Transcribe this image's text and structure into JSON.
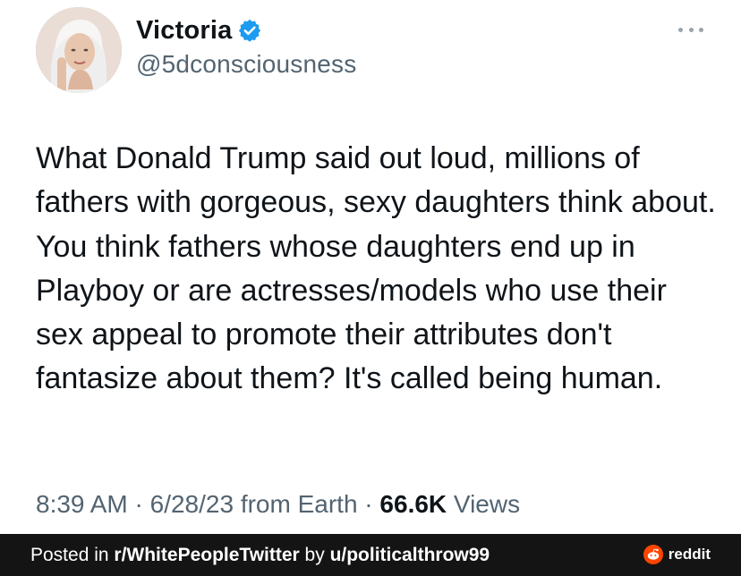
{
  "tweet": {
    "author": {
      "display_name": "Victoria",
      "handle": "@5dconsciousness",
      "verified": true
    },
    "text": "What Donald Trump said out loud, millions of fathers with gorgeous, sexy daughters think about. You think fathers whose daughters end up in Playboy or are actresses/models who use their sex appeal to promote their attributes don't fantasize about them? It's called being human.",
    "meta": {
      "time": "8:39 AM",
      "separator1": " · ",
      "date": "6/28/23",
      "source": " from Earth",
      "separator2": " · ",
      "views_count": "66.6K",
      "views_label": " Views"
    }
  },
  "footer": {
    "posted_in_prefix": "Posted in ",
    "subreddit": "r/WhitePeopleTwitter",
    "by_text": " by ",
    "user": "u/politicalthrow99",
    "brand": "reddit"
  },
  "colors": {
    "text_primary": "#0f1419",
    "text_secondary": "#536471",
    "verified_blue": "#1d9bf0",
    "footer_bg": "#141414",
    "reddit_orange": "#ff4500"
  },
  "icons": {
    "verified": "verified-badge-icon",
    "more": "more-options-icon",
    "reddit": "reddit-logo-icon"
  }
}
